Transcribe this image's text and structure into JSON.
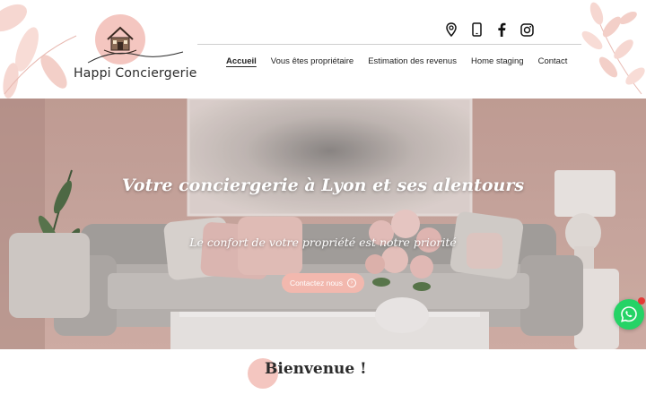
{
  "brand": {
    "name": "Happi Conciergerie",
    "accent": "#f4c6c0"
  },
  "social": [
    {
      "icon": "map-pin-icon",
      "label": "Localisation"
    },
    {
      "icon": "phone-icon",
      "label": "Téléphone"
    },
    {
      "icon": "facebook-icon",
      "label": "Facebook"
    },
    {
      "icon": "instagram-icon",
      "label": "Instagram"
    }
  ],
  "nav": {
    "items": [
      {
        "label": "Accueil",
        "active": true
      },
      {
        "label": "Vous êtes propriétaire",
        "active": false
      },
      {
        "label": "Estimation des revenus",
        "active": false
      },
      {
        "label": "Home staging",
        "active": false
      },
      {
        "label": "Contact",
        "active": false
      }
    ]
  },
  "hero": {
    "title": "Votre conciergerie à Lyon et ses alentours",
    "subtitle": "Le confort de votre propriété est notre priorité",
    "cta_label": "Contactez nous",
    "cta_color": "#f2b8ae"
  },
  "welcome": {
    "title": "Bienvenue !"
  },
  "whatsapp": {
    "icon": "whatsapp-icon",
    "color": "#25d366"
  }
}
